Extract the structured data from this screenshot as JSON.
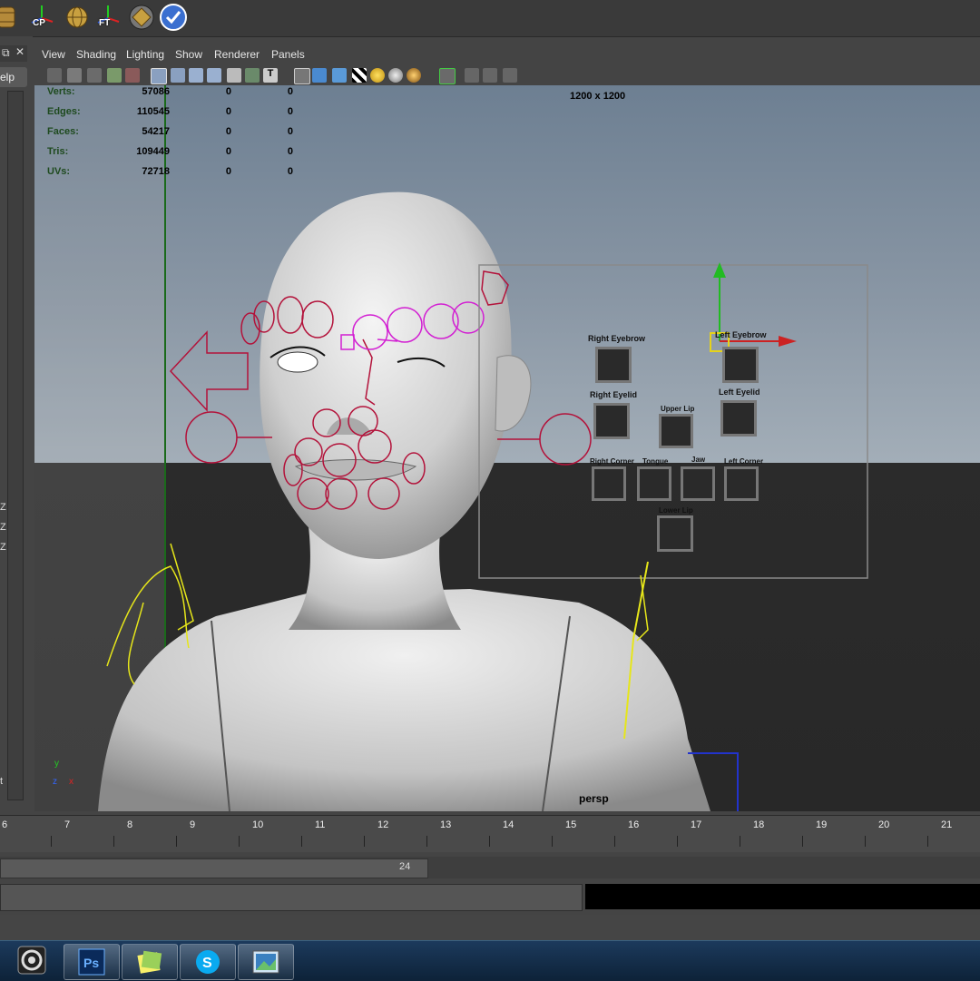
{
  "shelf": {
    "icons": [
      {
        "name": "barrel-icon",
        "label": ""
      },
      {
        "name": "cp-axis-icon",
        "label": "CP"
      },
      {
        "name": "globe-icon",
        "label": ""
      },
      {
        "name": "ft-axis-icon",
        "label": "FT"
      },
      {
        "name": "disc-tool-icon",
        "label": ""
      },
      {
        "name": "checkmark-icon",
        "label": ""
      }
    ]
  },
  "left_panel": {
    "help_label": "elp",
    "axis_labels": [
      "Z",
      "Z",
      "Z"
    ],
    "t_label": "t"
  },
  "panel_menu": {
    "items": [
      "View",
      "Shading",
      "Lighting",
      "Show",
      "Renderer",
      "Panels"
    ]
  },
  "hud": {
    "rows": [
      {
        "label": "Verts:",
        "value": "57086",
        "sel": "0",
        "comp": "0"
      },
      {
        "label": "Edges:",
        "value": "110545",
        "sel": "0",
        "comp": "0"
      },
      {
        "label": "Faces:",
        "value": "54217",
        "sel": "0",
        "comp": "0"
      },
      {
        "label": "Tris:",
        "value": "109449",
        "sel": "0",
        "comp": "0"
      },
      {
        "label": "UVs:",
        "value": "72718",
        "sel": "0",
        "comp": "0"
      }
    ],
    "resolution": "1200 x 1200",
    "camera": "persp"
  },
  "facial_gui": {
    "controls": [
      "Right Eyebrow",
      "Left Eyebrow",
      "Right Eyelid",
      "Left Eyelid",
      "Upper Lip",
      "Right Corner",
      "Tongue",
      "Jaw",
      "Left Corner",
      "Lower Lip"
    ]
  },
  "timeline": {
    "ticks": [
      "6",
      "7",
      "8",
      "9",
      "10",
      "11",
      "12",
      "13",
      "14",
      "15",
      "16",
      "17",
      "18",
      "19",
      "20",
      "21"
    ],
    "range_end": "24"
  },
  "taskbar": {
    "apps": [
      {
        "name": "maya-app-icon"
      },
      {
        "name": "photoshop-app-icon",
        "label": "Ps"
      },
      {
        "name": "sticky-notes-app-icon"
      },
      {
        "name": "skype-app-icon",
        "label": "S"
      },
      {
        "name": "photo-viewer-app-icon"
      }
    ]
  },
  "colors": {
    "rig_red": "#b3123a",
    "rig_magenta": "#d21fd2",
    "curve_yellow": "#e6e61a",
    "hud_green": "#1e4a1e"
  }
}
